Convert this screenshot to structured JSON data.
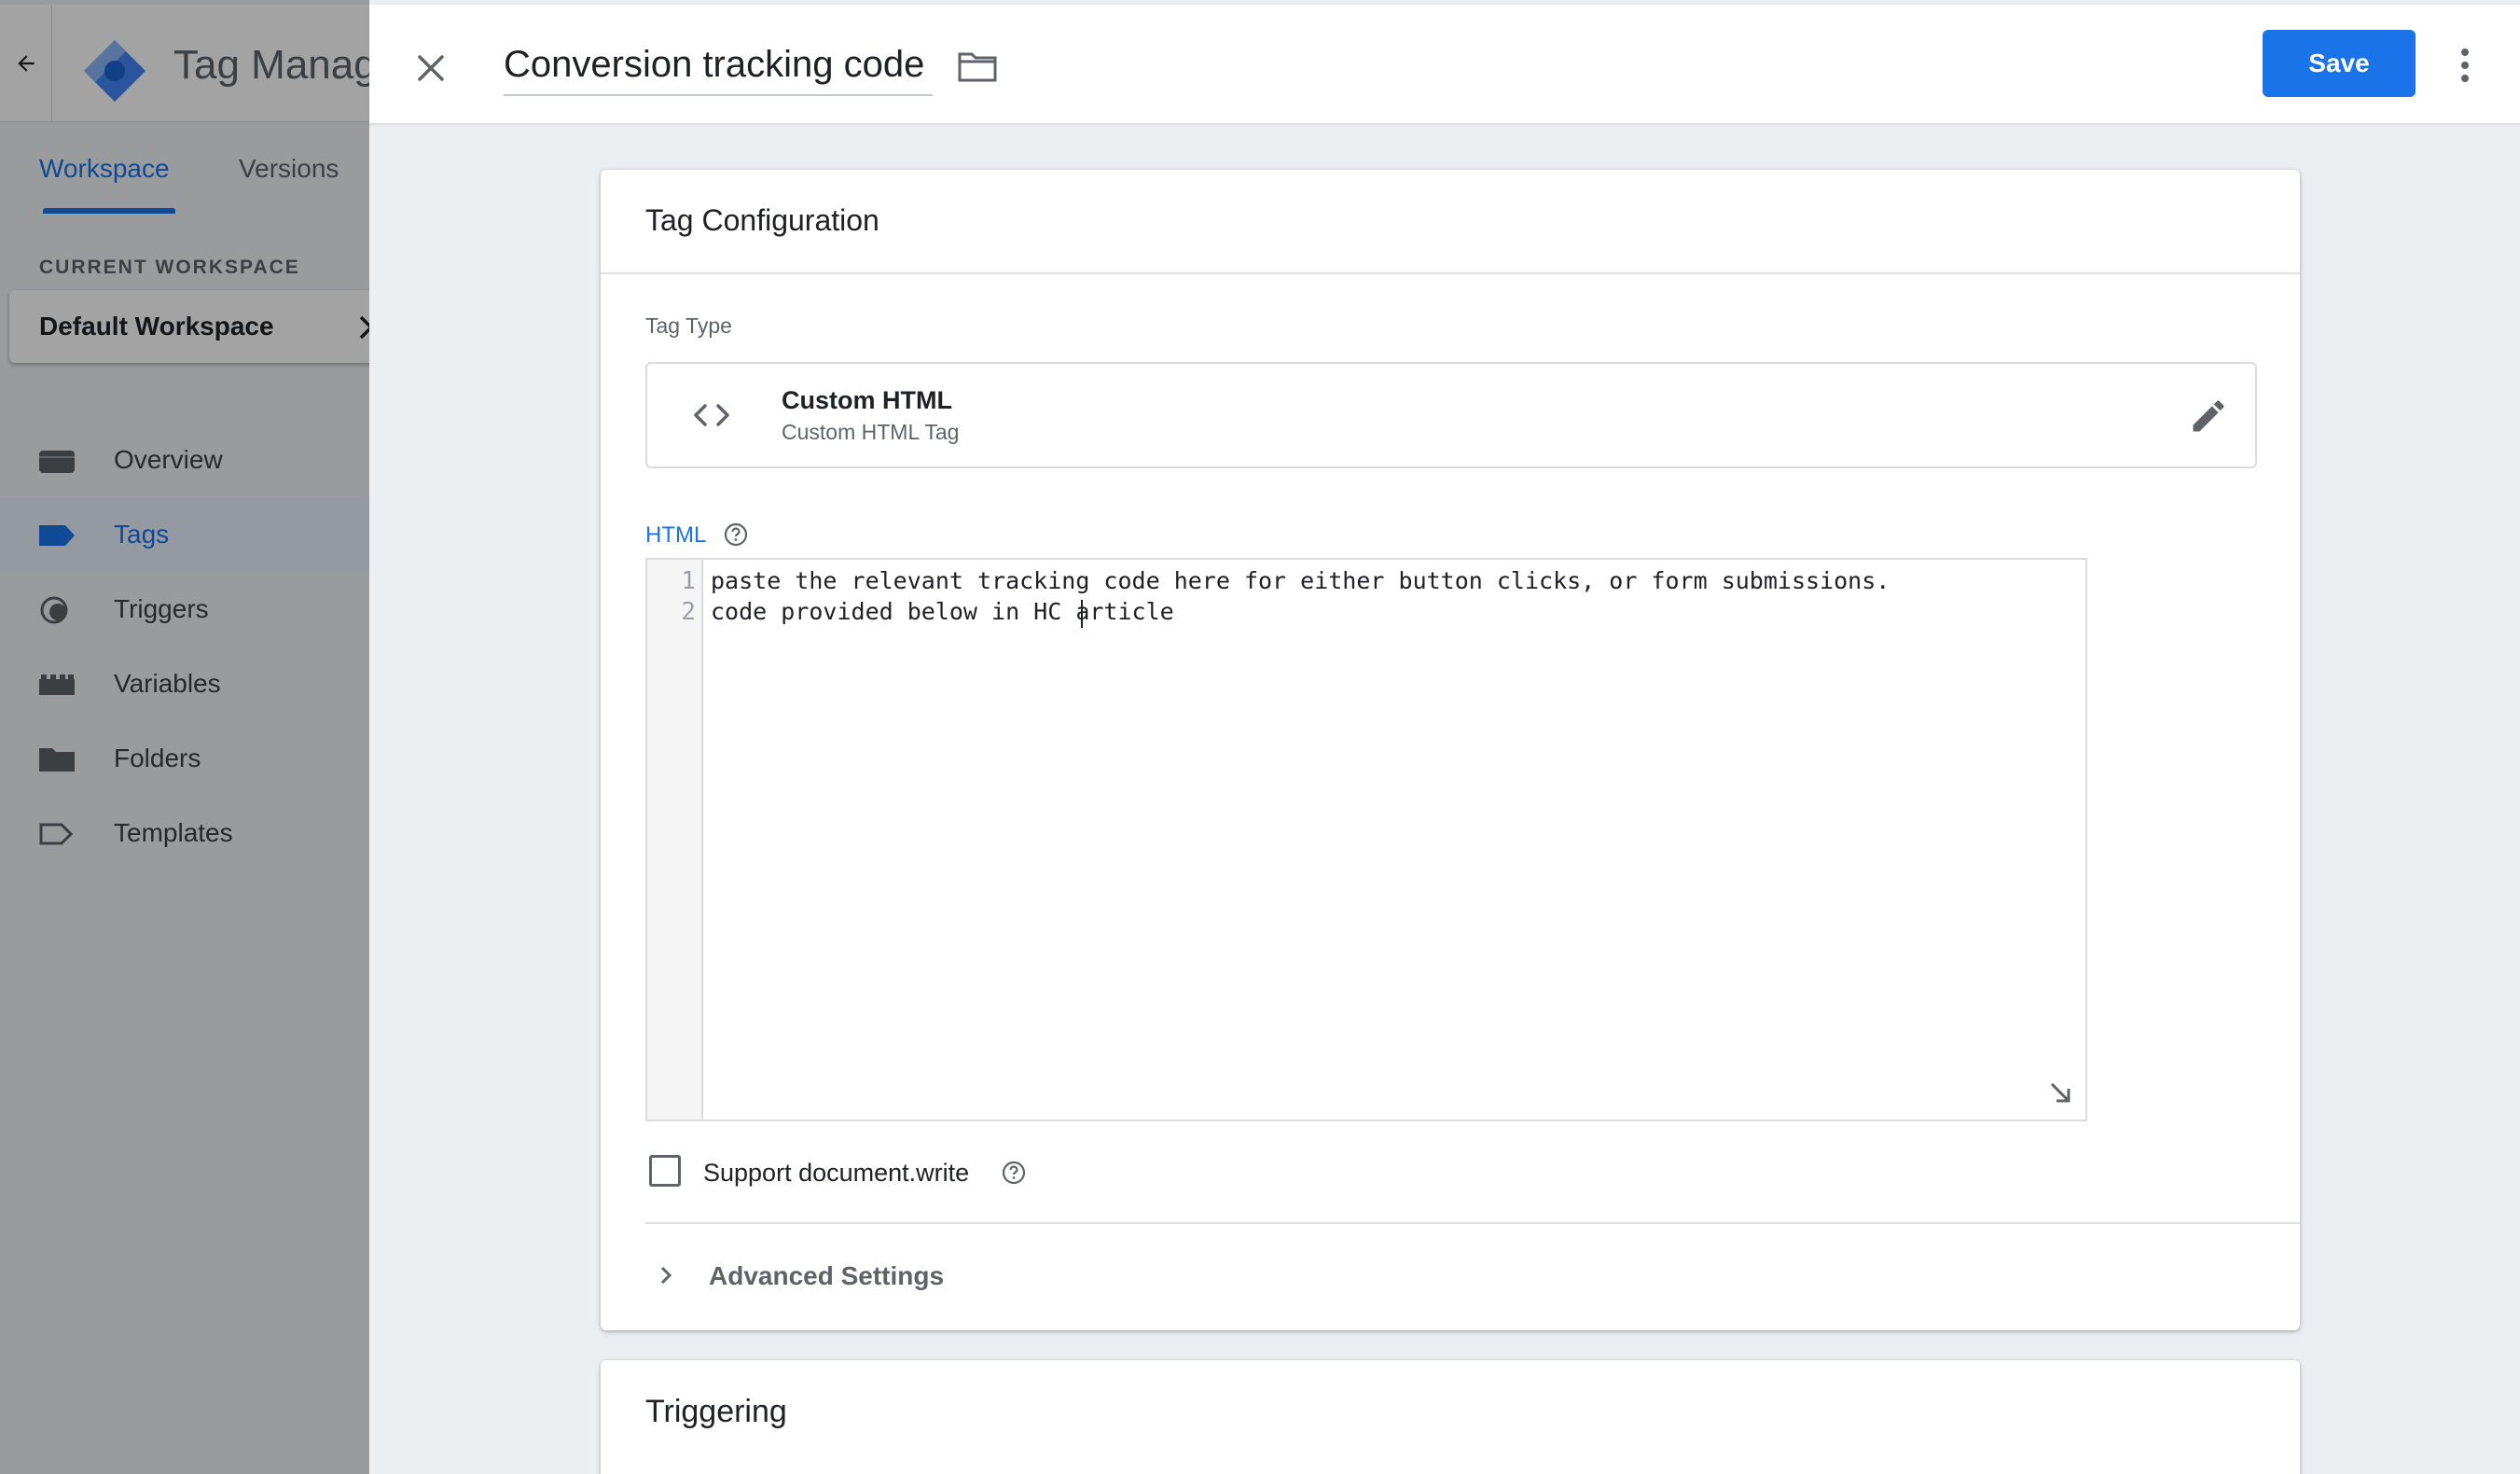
{
  "sidebar": {
    "app_title": "Tag Manag",
    "tabs": [
      {
        "label": "Workspace",
        "active": true
      },
      {
        "label": "Versions",
        "active": false
      }
    ],
    "current_workspace_label": "CURRENT WORKSPACE",
    "workspace_name": "Default Workspace",
    "nav": [
      {
        "label": "Overview",
        "icon": "briefcase-icon",
        "active": false
      },
      {
        "label": "Tags",
        "icon": "tag-icon",
        "active": true
      },
      {
        "label": "Triggers",
        "icon": "trigger-icon",
        "active": false
      },
      {
        "label": "Variables",
        "icon": "variables-icon",
        "active": false
      },
      {
        "label": "Folders",
        "icon": "folder-icon",
        "active": false
      },
      {
        "label": "Templates",
        "icon": "template-icon",
        "active": false
      }
    ]
  },
  "header": {
    "tag_name": "Conversion tracking code",
    "save_label": "Save"
  },
  "tag_config": {
    "title": "Tag Configuration",
    "tag_type_label": "Tag Type",
    "tag_type_name": "Custom HTML",
    "tag_type_desc": "Custom HTML Tag",
    "html_label": "HTML",
    "code_lines": [
      {
        "num": "1",
        "text": "paste the relevant tracking code here for either button clicks, or form submissions."
      },
      {
        "num": "2",
        "text": "code provided below in HC article"
      }
    ],
    "support_doc_write_label": "Support document.write",
    "support_doc_write_checked": false,
    "advanced_label": "Advanced Settings"
  },
  "triggering": {
    "title": "Triggering"
  },
  "colors": {
    "accent": "#1a73e8",
    "sidebar_overlay": "rgba(0,0,0,0.36)"
  }
}
